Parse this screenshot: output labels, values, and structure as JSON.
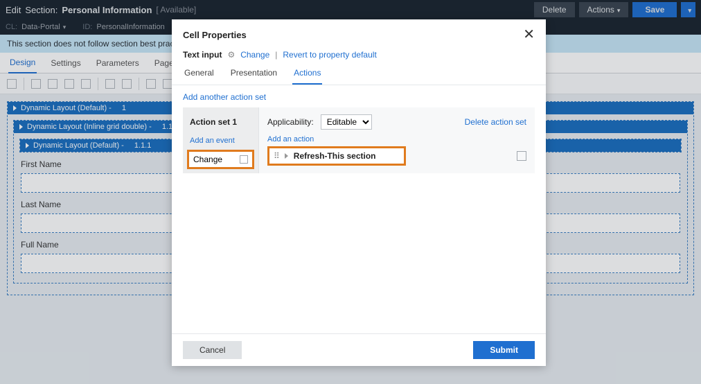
{
  "header": {
    "edit": "Edit",
    "section_label": "Section:",
    "section_name": "Personal Information",
    "status": "[ Available]",
    "delete": "Delete",
    "actions": "Actions",
    "save": "Save"
  },
  "subheader": {
    "cl_label": "CL:",
    "cl_value": "Data-Portal",
    "id_label": "ID:",
    "id_value": "PersonalInformation"
  },
  "warning": "This section does not follow section best pract",
  "tabs": {
    "design": "Design",
    "settings": "Settings",
    "parameters": "Parameters",
    "pages": "Pages"
  },
  "layouts": {
    "l1": "Dynamic Layout (Default)  -",
    "l1_num": "1",
    "l2": "Dynamic Layout (Inline grid double)  -",
    "l2_num": "1.1",
    "l3": "Dynamic Layout (Default)  -",
    "l3_num": "1.1.1"
  },
  "fields": {
    "first": "First Name",
    "last": "Last Name",
    "full": "Full Name"
  },
  "modal": {
    "title": "Cell Properties",
    "type": "Text input",
    "change": "Change",
    "revert": "Revert to property default",
    "tab_general": "General",
    "tab_presentation": "Presentation",
    "tab_actions": "Actions",
    "add_set": "Add another action set",
    "set_name": "Action set 1",
    "applicability": "Applicability:",
    "app_value": "Editable",
    "delete_set": "Delete action set",
    "add_event": "Add an event",
    "event_name": "Change",
    "add_action": "Add an action",
    "action_name": "Refresh-This section",
    "cancel": "Cancel",
    "submit": "Submit"
  }
}
